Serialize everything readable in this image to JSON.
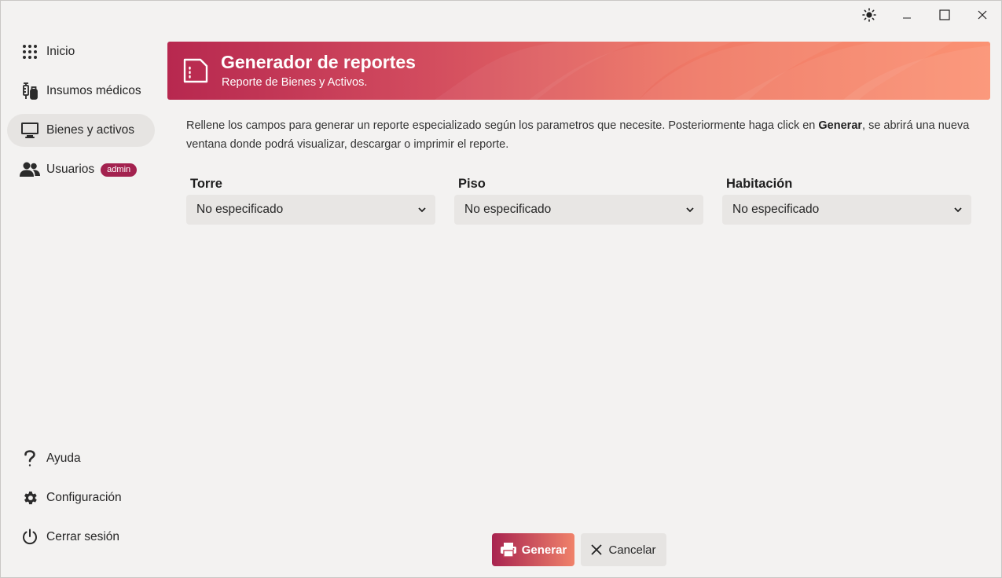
{
  "window": {
    "controls": [
      "theme-toggle",
      "minimize",
      "maximize",
      "close"
    ]
  },
  "sidebar": {
    "items": [
      {
        "label": "Inicio",
        "icon": "grid-dots-icon"
      },
      {
        "label": "Insumos médicos",
        "icon": "medical-supplies-icon"
      },
      {
        "label": "Bienes y activos",
        "icon": "monitor-icon",
        "active": true
      },
      {
        "label": "Usuarios",
        "icon": "users-icon",
        "badge": "admin"
      }
    ],
    "bottom_items": [
      {
        "label": "Ayuda",
        "icon": "question-icon"
      },
      {
        "label": "Configuración",
        "icon": "gear-icon"
      },
      {
        "label": "Cerrar sesión",
        "icon": "power-icon"
      }
    ]
  },
  "header": {
    "title": "Generador de reportes",
    "subtitle": "Reporte de Bienes y Activos.",
    "icon": "document-icon"
  },
  "description": {
    "before": "Rellene los campos para generar un reporte especializado según los parametros que necesite. Posteriormente haga click en ",
    "bold": "Generar",
    "after": ", se abrirá una nueva ventana donde podrá visualizar, descargar o imprimir el reporte."
  },
  "fields": [
    {
      "label": "Torre",
      "value": "No especificado"
    },
    {
      "label": "Piso",
      "value": "No especificado"
    },
    {
      "label": "Habitación",
      "value": "No especificado"
    }
  ],
  "actions": {
    "generate_label": "Generar",
    "cancel_label": "Cancelar"
  },
  "colors": {
    "accent": "#a3224f",
    "banner_start": "#b7284f",
    "banner_end": "#fb9273",
    "active_nav": "#e6e4e2"
  }
}
